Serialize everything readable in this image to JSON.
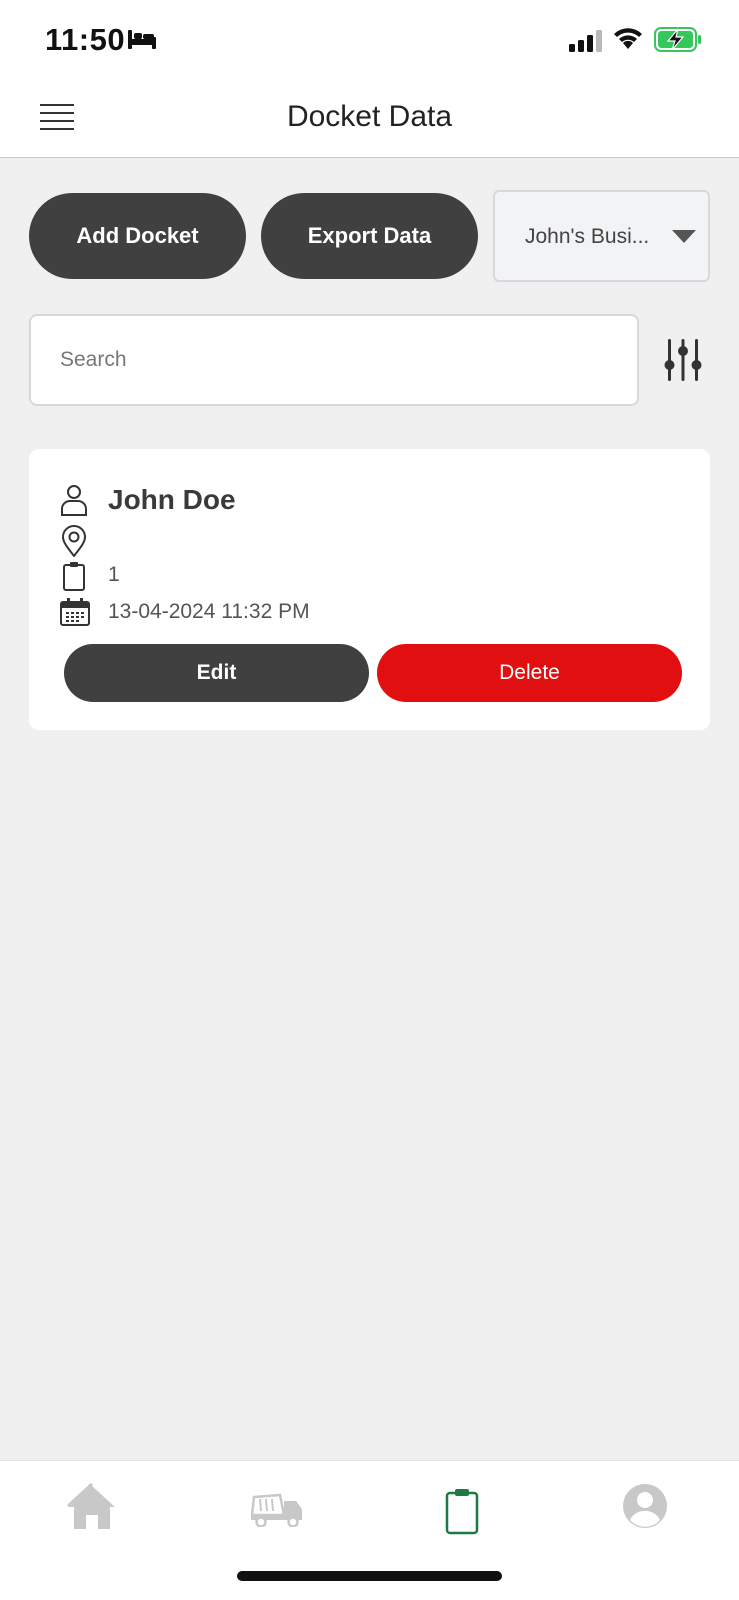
{
  "status_bar": {
    "time": "11:50",
    "icons": [
      "bed-icon",
      "cellular-signal-icon",
      "wifi-icon",
      "battery-charging-icon"
    ],
    "battery_color": "#34c759"
  },
  "header": {
    "title": "Docket Data",
    "menu_icon": "hamburger-menu-icon"
  },
  "toolbar": {
    "add_label": "Add Docket",
    "export_label": "Export Data",
    "business_selected": "John's Busi..."
  },
  "search": {
    "placeholder": "Search",
    "value": "",
    "filter_icon": "sliders-filter-icon"
  },
  "dockets": [
    {
      "name": "John Doe",
      "location": "",
      "number": "1",
      "datetime": "13-04-2024 11:32 PM",
      "edit_label": "Edit",
      "delete_label": "Delete"
    }
  ],
  "tab_bar": {
    "tabs": [
      {
        "icon": "home-icon",
        "active": false
      },
      {
        "icon": "truck-icon",
        "active": false
      },
      {
        "icon": "clipboard-icon",
        "active": true
      },
      {
        "icon": "profile-icon",
        "active": false
      }
    ],
    "active_color": "#1e7a45",
    "inactive_color": "#c8c8c8"
  },
  "colors": {
    "button_dark": "#404040",
    "delete_red": "#e10f10",
    "background": "#f0f0f1"
  }
}
